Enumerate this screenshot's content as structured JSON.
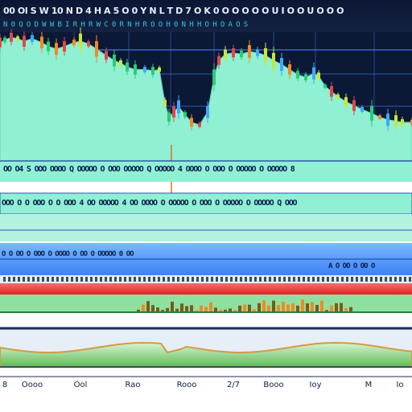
{
  "window": {
    "title": "00 Ol S W 10 N D 4 H A 5 O 0 Y N L T D 7 O K 0 O O O O O U I O O U O O O",
    "subtitle": "N 0 Q O D W W B I R H R W C 0 R N H R O O H 0 N H H O H O A O S"
  },
  "colors": {
    "header_bg": "#0f1a3a",
    "plot_bg": "#0b1836",
    "area_fill": "#8ff0d4",
    "band_green": "#2ecc71",
    "band_blue": "#3b82f6",
    "band_red": "#ef4444",
    "accent_orange": "#f08a24"
  },
  "rows": {
    "row1": "OO O4 S OOO OOOO Q OOOOO O OOO OOOOO Q OOOOO 4 OOOO O OOO O OOOOO O OOOOO 8",
    "row2": "OOO O O OOO O O OOO 4 OO OOOOO 4 OO OOOO O OOOOO O OOO O OOOOO O OOOOO Q OOO",
    "row3": "O O OO O OOO O OOOO O OO O OOOOO 0 OO",
    "row4": "A O OO O OO O"
  },
  "xaxis": {
    "labels": [
      "8",
      "Oooo",
      "Ool",
      "Rao",
      "Rooo",
      "2/7",
      "Booo",
      "Ioy",
      "M",
      "Io"
    ]
  },
  "chart_data": {
    "type": "area",
    "title": "",
    "xlabel": "",
    "ylabel": "",
    "x": [
      0,
      6,
      14,
      22,
      30,
      40,
      52,
      60,
      70,
      80,
      92,
      100,
      110,
      120,
      132,
      142,
      150,
      158,
      168,
      180,
      190,
      198,
      205,
      210,
      216,
      222,
      230,
      238,
      248,
      258,
      266,
      272,
      280,
      290,
      300,
      310,
      320,
      330,
      340,
      350,
      360,
      370,
      380,
      390,
      396,
      404,
      412,
      420,
      430,
      440,
      450,
      462,
      472,
      482,
      492,
      500,
      512
    ],
    "y": [
      92,
      94,
      96,
      95,
      93,
      95,
      92,
      89,
      87,
      89,
      92,
      93,
      91,
      87,
      82,
      78,
      76,
      73,
      71,
      71,
      70,
      71,
      45,
      34,
      38,
      42,
      36,
      30,
      28,
      38,
      65,
      78,
      83,
      84,
      83,
      85,
      84,
      82,
      78,
      75,
      71,
      67,
      65,
      68,
      66,
      58,
      54,
      50,
      46,
      43,
      40,
      37,
      34,
      32,
      31,
      30,
      30
    ],
    "ylim": [
      0,
      100
    ],
    "xlim": [
      0,
      512
    ],
    "grid": true
  }
}
